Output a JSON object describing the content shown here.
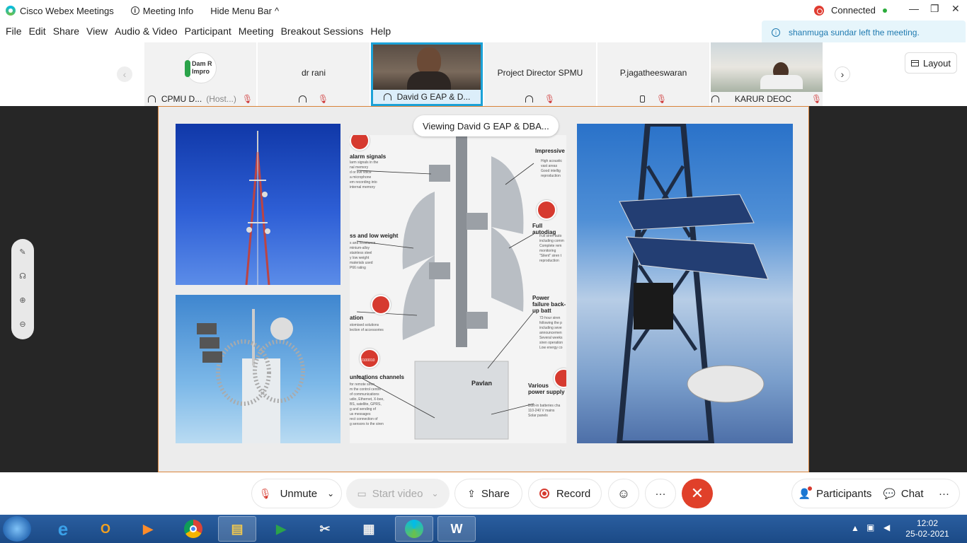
{
  "titlebar": {
    "app_name": "Cisco Webex Meetings",
    "meeting_info": "Meeting Info",
    "hide_menu_bar": "Hide Menu Bar",
    "hide_menu_chevron": "^",
    "connected": "Connected",
    "minimize": "—",
    "restore": "❐",
    "close": "✕"
  },
  "menu": [
    "File",
    "Edit",
    "Share",
    "View",
    "Audio & Video",
    "Participant",
    "Meeting",
    "Breakout Sessions",
    "Help"
  ],
  "notification": {
    "text": "shanmuga sundar left the meeting."
  },
  "participants": [
    {
      "label": "CPMU D...",
      "host": "(Host...)",
      "logo_text": "Dam R Impro"
    },
    {
      "label": "",
      "center_name": "dr rani"
    },
    {
      "label": "David G EAP & D..."
    },
    {
      "label": "",
      "center_name": "Project Director SPMU"
    },
    {
      "label": "",
      "center_name": "P.jagatheeswaran"
    },
    {
      "label": "KARUR DEOC"
    }
  ],
  "nav": {
    "prev": "‹",
    "next": "›"
  },
  "layout_button": "Layout",
  "share": {
    "viewing_label": "Viewing David G EAP & DBA...",
    "slide": {
      "alarm_signals": "alarm signals",
      "low_weight": "ss and low weight",
      "customization": "ation",
      "channels": "unications channels",
      "brand": "Pavlan",
      "impressive": "Impressive",
      "full_autodiag": "Full autodiag",
      "power_failure": "Power failure back-up batt",
      "various_power": "Various power supply",
      "small_1": "larm signals in the\nnal memory\nd or live voice\na microphone\nem recording into\ninternal memory",
      "small_2": "s and resistance\nminium-alloy\nstainless steel\ny low weight\nmaterials used\nP66 rating",
      "small_3": "stomised solutions\nlection of accessories",
      "small_4": "for remote siren\nm the control centre\nof communications\nudio, Ethernet, X-bee,\nBS, satellite, GPRS,\ng and sending of\nus messages\nrect connection of\ng sensors to the siren",
      "small_5": "High acoustic\nvast areas\nGood intellig\nreproduction",
      "small_6": "Full siren auto\nincluding comm\nComplete rem\nmonitoring\n\"Silent\" siren t\nreproduction",
      "small_7": "72-hour siren\nfollowing the p\nincluding seve\nannouncemen\nSeveral weeks\nsiren operation\nLow energy co",
      "small_8": "Built-in batteries cha\n110-240 V mains\nSolar panels",
      "badge_id": "0100010"
    }
  },
  "side_tools": [
    "✎",
    "☊",
    "⊕",
    "⊖"
  ],
  "controls": {
    "unmute": "Unmute",
    "start_video": "Start video",
    "share": "Share",
    "record": "Record",
    "reactions": "☺",
    "more": "···",
    "end": "✕",
    "participants": "Participants",
    "chat": "Chat",
    "more_right": "···",
    "chevron": "⌄"
  },
  "taskbar": {
    "time": "12:02",
    "date": "25-02-2021"
  },
  "colors": {
    "accent": "#1ba2d8",
    "end_call": "#e0402a",
    "connected_red": "#e03c31",
    "taskbar": "#1b4a86"
  }
}
